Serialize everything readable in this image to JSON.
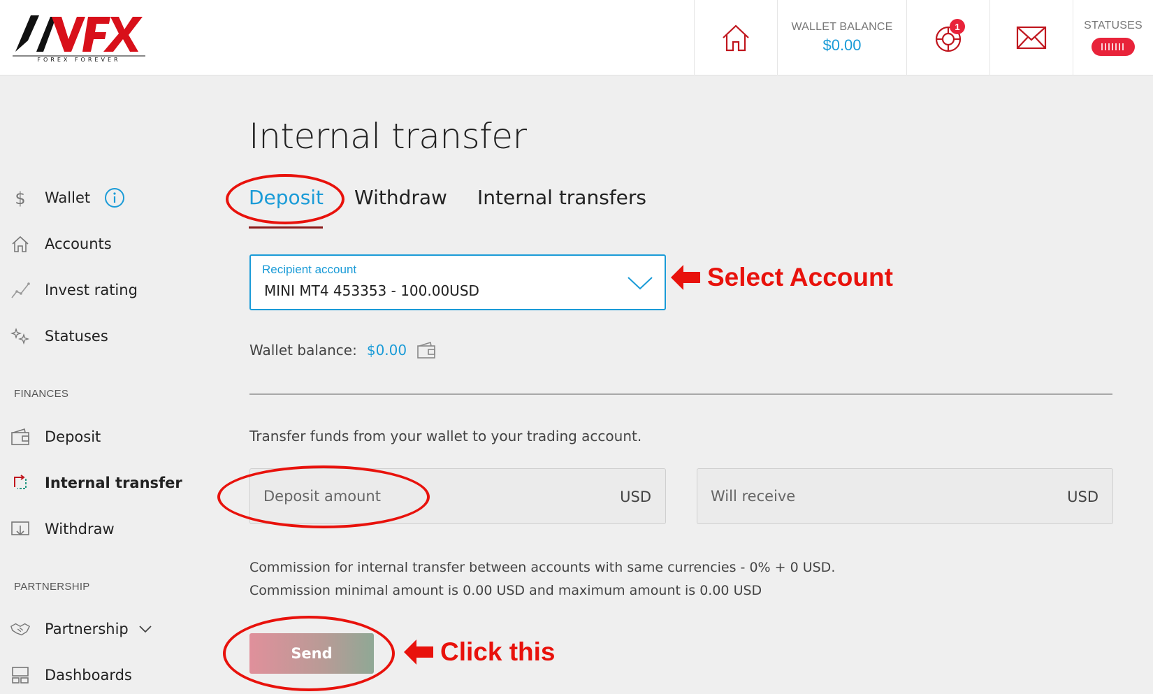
{
  "header": {
    "logo_text": "AVFX",
    "logo_tagline": "FOREX FOREVER",
    "wallet_label": "WALLET BALANCE",
    "wallet_value": "$0.00",
    "notification_count": "1",
    "statuses_label": "STATUSES",
    "colors": {
      "accent": "#1a9bd7",
      "brand_red": "#e8233a"
    }
  },
  "sidebar": {
    "items": [
      {
        "label": "Wallet",
        "icon": "dollar-icon"
      },
      {
        "label": "Accounts",
        "icon": "home-icon"
      },
      {
        "label": "Invest rating",
        "icon": "chart-line-icon"
      },
      {
        "label": "Statuses",
        "icon": "sparkle-icon"
      }
    ],
    "finances_heading": "FINANCES",
    "finances_items": [
      {
        "label": "Deposit",
        "icon": "wallet-icon"
      },
      {
        "label": "Internal transfer",
        "icon": "transfer-icon"
      },
      {
        "label": "Withdraw",
        "icon": "withdraw-icon"
      }
    ],
    "partnership_heading": "PARTNERSHIP",
    "partnership_items": [
      {
        "label": "Partnership",
        "icon": "handshake-icon"
      },
      {
        "label": "Dashboards",
        "icon": "dashboard-icon"
      }
    ]
  },
  "main": {
    "title": "Internal transfer",
    "tabs": [
      {
        "label": "Deposit",
        "active": true
      },
      {
        "label": "Withdraw",
        "active": false
      },
      {
        "label": "Internal transfers",
        "active": false
      }
    ],
    "recipient": {
      "label": "Recipient account",
      "value": "MINI MT4 453353 - 100.00USD"
    },
    "wallet_balance_label": "Wallet balance:",
    "wallet_balance_value": "$0.00",
    "description": "Transfer funds from your wallet to your trading account.",
    "amount_placeholder": "Deposit amount",
    "amount_currency": "USD",
    "receive_placeholder": "Will receive",
    "receive_currency": "USD",
    "commission_line1": "Commission for internal transfer between accounts with same currencies - 0% + 0 USD.",
    "commission_line2": "Commission minimal amount is 0.00 USD and maximum amount is 0.00 USD",
    "send_label": "Send"
  },
  "annotations": {
    "select_account": "Select Account",
    "click_this": "Click this",
    "color": "#e8120c"
  }
}
